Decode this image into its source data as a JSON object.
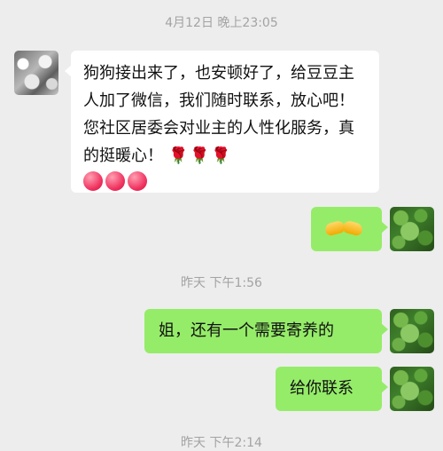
{
  "timestamps": {
    "first": "4月12日 晚上23:05",
    "second": "昨天 下午1:56",
    "third": "昨天 下午2:14"
  },
  "messages": {
    "incoming": {
      "text": "狗狗接出来了，也安顿好了，给豆豆主人加了微信，我们随时联系，放心吧！您社区居委会对业主的人性化服务，真的挺暖心！",
      "emoji_icons": [
        "rose-icon",
        "rose-icon",
        "rose-icon",
        "heart-icon",
        "heart-icon",
        "heart-icon"
      ]
    },
    "outgoing": [
      {
        "emoji_icon": "handshake-icon"
      },
      {
        "text": "姐，还有一个需要寄养的"
      },
      {
        "text": "给你联系"
      }
    ]
  },
  "colors": {
    "background": "#ededed",
    "incoming_bubble": "#ffffff",
    "outgoing_bubble": "#95ec69",
    "timestamp_text": "#a3a3a3"
  }
}
